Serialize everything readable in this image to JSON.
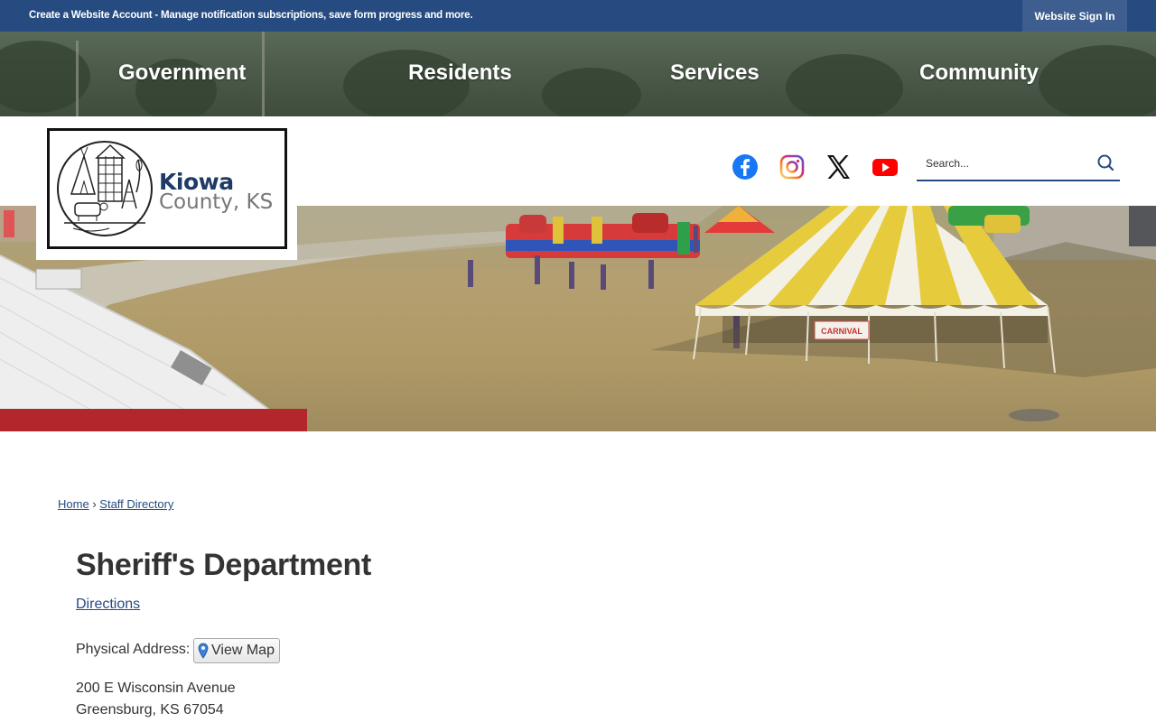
{
  "topbar": {
    "account_link": "Create a Website Account - Manage notification subscriptions, save form progress and more.",
    "signin_label": "Website Sign In",
    "bg_color": "#264b80"
  },
  "nav": {
    "items": [
      {
        "label": "Government"
      },
      {
        "label": "Residents"
      },
      {
        "label": "Services"
      },
      {
        "label": "Community"
      }
    ]
  },
  "logo": {
    "name": "Kiowa",
    "county": "County, KS"
  },
  "social": {
    "icons": [
      "facebook-icon",
      "instagram-icon",
      "x-icon",
      "youtube-icon"
    ]
  },
  "search": {
    "placeholder": "Search..."
  },
  "hero": {
    "banner_sign": "CARNIVAL"
  },
  "breadcrumb": {
    "home": "Home",
    "separator": "›",
    "current": "Staff Directory"
  },
  "main": {
    "title": "Sheriff's Department",
    "directions_label": "Directions",
    "physical_address_label": "Physical Address:",
    "view_map_label": "View Map",
    "address_line1": "200 E Wisconsin Avenue",
    "address_line2": "Greensburg, KS 67054"
  }
}
